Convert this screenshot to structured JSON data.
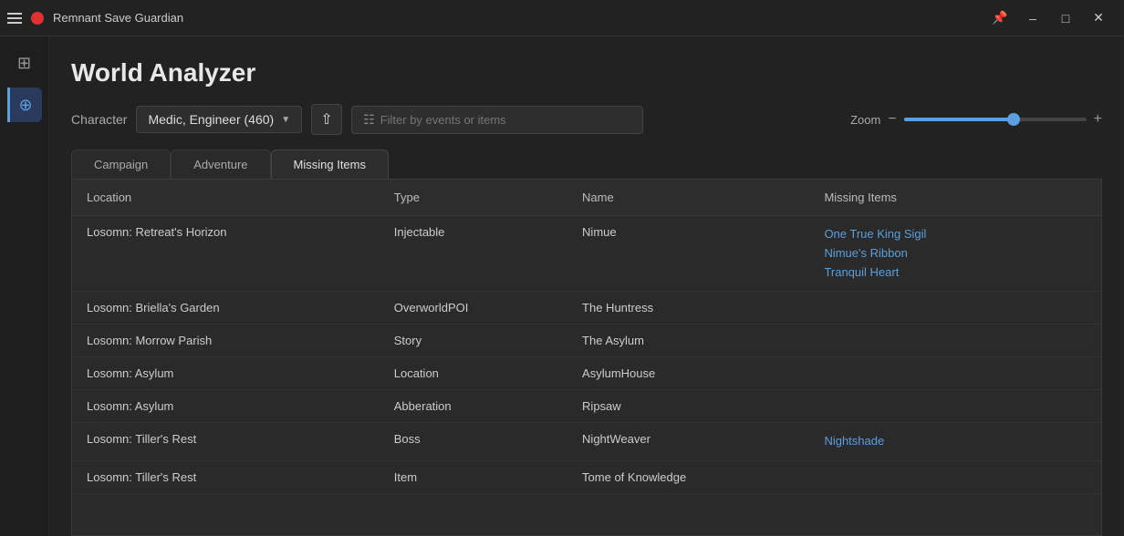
{
  "titleBar": {
    "appName": "Remnant Save Guardian"
  },
  "sidebar": {
    "items": [
      {
        "id": "database",
        "icon": "⊞",
        "active": false
      },
      {
        "id": "world",
        "icon": "⊕",
        "active": true
      }
    ]
  },
  "page": {
    "title": "World Analyzer"
  },
  "toolbar": {
    "characterLabel": "Character",
    "characterValue": "Medic, Engineer (460)",
    "filterPlaceholder": "Filter by events or items",
    "zoomLabel": "Zoom",
    "zoomPercent": 60
  },
  "tabs": [
    {
      "id": "campaign",
      "label": "Campaign",
      "active": false
    },
    {
      "id": "adventure",
      "label": "Adventure",
      "active": false
    },
    {
      "id": "missing",
      "label": "Missing Items",
      "active": true
    }
  ],
  "table": {
    "columns": [
      {
        "id": "location",
        "label": "Location"
      },
      {
        "id": "type",
        "label": "Type"
      },
      {
        "id": "name",
        "label": "Name"
      },
      {
        "id": "missing",
        "label": "Missing Items"
      }
    ],
    "rows": [
      {
        "location": "Losomn: Retreat's Horizon",
        "type": "Injectable",
        "name": "Nimue",
        "missingItems": [
          "One True King Sigil",
          "Nimue's Ribbon",
          "Tranquil Heart"
        ]
      },
      {
        "location": "Losomn: Briella's Garden",
        "type": "OverworldPOI",
        "name": "The Huntress",
        "missingItems": []
      },
      {
        "location": "Losomn: Morrow Parish",
        "type": "Story",
        "name": "The Asylum",
        "missingItems": []
      },
      {
        "location": "Losomn: Asylum",
        "type": "Location",
        "name": "AsylumHouse",
        "missingItems": []
      },
      {
        "location": "Losomn: Asylum",
        "type": "Abberation",
        "name": "Ripsaw",
        "missingItems": []
      },
      {
        "location": "Losomn: Tiller's Rest",
        "type": "Boss",
        "name": "NightWeaver",
        "missingItems": [
          "Nightshade"
        ]
      },
      {
        "location": "Losomn: Tiller's Rest",
        "type": "Item",
        "name": "Tome of Knowledge",
        "missingItems": []
      }
    ]
  }
}
